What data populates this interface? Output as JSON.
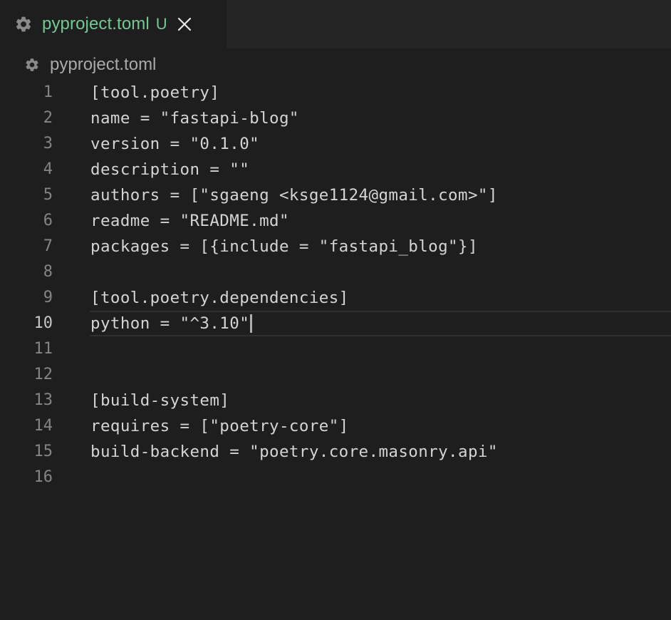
{
  "tab": {
    "icon": "gear-icon",
    "label": "pyproject.toml",
    "status": "U",
    "status_color": "#73c991",
    "close_icon": "close-icon"
  },
  "breadcrumb": {
    "icon": "gear-icon",
    "label": "pyproject.toml"
  },
  "editor": {
    "current_line": 10,
    "lines": [
      {
        "number": "1",
        "text": "[tool.poetry]"
      },
      {
        "number": "2",
        "text": "name = \"fastapi-blog\""
      },
      {
        "number": "3",
        "text": "version = \"0.1.0\""
      },
      {
        "number": "4",
        "text": "description = \"\""
      },
      {
        "number": "5",
        "text": "authors = [\"sgaeng <ksge1124@gmail.com>\"]"
      },
      {
        "number": "6",
        "text": "readme = \"README.md\""
      },
      {
        "number": "7",
        "text": "packages = [{include = \"fastapi_blog\"}]"
      },
      {
        "number": "8",
        "text": ""
      },
      {
        "number": "9",
        "text": "[tool.poetry.dependencies]"
      },
      {
        "number": "10",
        "text": "python = \"^3.10\""
      },
      {
        "number": "11",
        "text": ""
      },
      {
        "number": "12",
        "text": ""
      },
      {
        "number": "13",
        "text": "[build-system]"
      },
      {
        "number": "14",
        "text": "requires = [\"poetry-core\"]"
      },
      {
        "number": "15",
        "text": "build-backend = \"poetry.core.masonry.api\""
      },
      {
        "number": "16",
        "text": ""
      }
    ]
  }
}
